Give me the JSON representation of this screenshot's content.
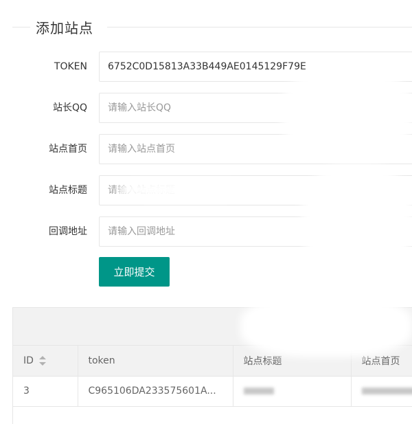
{
  "page": {
    "title": "添加站点"
  },
  "form": {
    "fields": [
      {
        "label": "TOKEN",
        "value": "6752C0D15813A33B449AE0145129F79E",
        "placeholder": ""
      },
      {
        "label": "站长QQ",
        "value": "",
        "placeholder": "请输入站长QQ"
      },
      {
        "label": "站点首页",
        "value": "",
        "placeholder": "请输入站点首页"
      },
      {
        "label": "站点标题",
        "value": "",
        "placeholder": "请输入站点标题"
      },
      {
        "label": "回调地址",
        "value": "",
        "placeholder": "请输入回调地址"
      }
    ],
    "submit_label": "立即提交"
  },
  "table": {
    "headers": [
      "ID",
      "token",
      "站点标题",
      "站点首页"
    ],
    "rows": [
      {
        "id": "3",
        "token": "C965106DA233575601A...",
        "title": "",
        "home": ""
      }
    ]
  }
}
